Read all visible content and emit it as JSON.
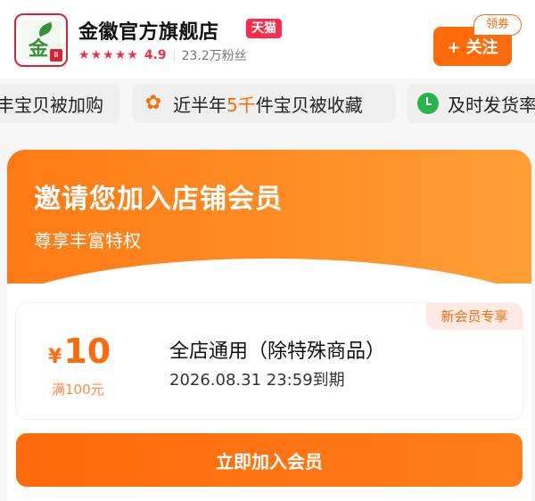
{
  "header": {
    "shop_name": "金徽官方旗舰店",
    "tmall_tag": "天猫",
    "logo_text": "金徽",
    "logo_badge": "Ⅲ",
    "rating": "4.9",
    "stars": 5,
    "fans": "23.2万粉丝",
    "follow_label": "+ 关注",
    "coupon_tag": "领券"
  },
  "tags": [
    {
      "text": "丰宝贝被加购"
    },
    {
      "text_pre": "近半年",
      "highlight": "5千",
      "text_post": "件宝贝被收藏"
    },
    {
      "text": "及时发货率"
    }
  ],
  "member": {
    "title": "邀请您加入店铺会员",
    "subtitle": "尊享丰富特权",
    "coupon": {
      "currency": "¥",
      "amount": "10",
      "condition": "满100元",
      "title": "全店通用（除特殊商品）",
      "expire": "2026.08.31 23:59到期",
      "new_tag": "新会员专享"
    },
    "join_label": "立即加入会员"
  },
  "colors": {
    "accent": "#ff6a0a",
    "tmall": "#ff2b4b",
    "green": "#28b34b"
  }
}
